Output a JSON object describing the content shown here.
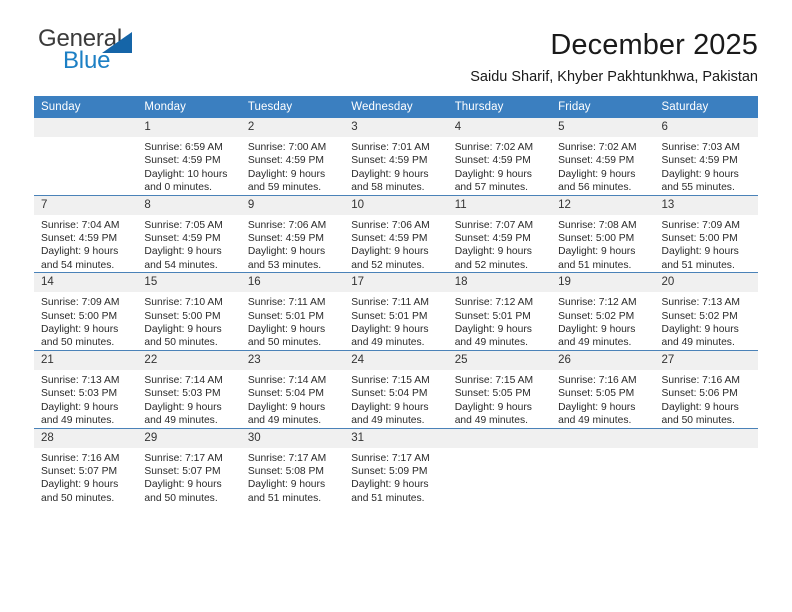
{
  "brand": {
    "name_top": "General",
    "name_bottom": "Blue",
    "triangle_color": "#1565a8",
    "blue_color": "#1c7fc4",
    "gray_color": "#3b3b3b"
  },
  "header": {
    "title": "December 2025",
    "subtitle": "Saidu Sharif, Khyber Pakhtunkhwa, Pakistan"
  },
  "theme": {
    "header_bg": "#3b7fc0",
    "header_text": "#ffffff",
    "daynum_bg": "#f0f0f0",
    "row_divider": "#4a82b8",
    "cell_bg": "#ffffff",
    "body_text": "#2a2a2a"
  },
  "weekday_headers": [
    "Sunday",
    "Monday",
    "Tuesday",
    "Wednesday",
    "Thursday",
    "Friday",
    "Saturday"
  ],
  "weeks": [
    [
      {
        "day": "",
        "sunrise": "",
        "sunset": "",
        "daylight_line1": "",
        "daylight_line2": "",
        "empty": true
      },
      {
        "day": "1",
        "sunrise": "Sunrise: 6:59 AM",
        "sunset": "Sunset: 4:59 PM",
        "daylight_line1": "Daylight: 10 hours",
        "daylight_line2": "and 0 minutes."
      },
      {
        "day": "2",
        "sunrise": "Sunrise: 7:00 AM",
        "sunset": "Sunset: 4:59 PM",
        "daylight_line1": "Daylight: 9 hours",
        "daylight_line2": "and 59 minutes."
      },
      {
        "day": "3",
        "sunrise": "Sunrise: 7:01 AM",
        "sunset": "Sunset: 4:59 PM",
        "daylight_line1": "Daylight: 9 hours",
        "daylight_line2": "and 58 minutes."
      },
      {
        "day": "4",
        "sunrise": "Sunrise: 7:02 AM",
        "sunset": "Sunset: 4:59 PM",
        "daylight_line1": "Daylight: 9 hours",
        "daylight_line2": "and 57 minutes."
      },
      {
        "day": "5",
        "sunrise": "Sunrise: 7:02 AM",
        "sunset": "Sunset: 4:59 PM",
        "daylight_line1": "Daylight: 9 hours",
        "daylight_line2": "and 56 minutes."
      },
      {
        "day": "6",
        "sunrise": "Sunrise: 7:03 AM",
        "sunset": "Sunset: 4:59 PM",
        "daylight_line1": "Daylight: 9 hours",
        "daylight_line2": "and 55 minutes."
      }
    ],
    [
      {
        "day": "7",
        "sunrise": "Sunrise: 7:04 AM",
        "sunset": "Sunset: 4:59 PM",
        "daylight_line1": "Daylight: 9 hours",
        "daylight_line2": "and 54 minutes."
      },
      {
        "day": "8",
        "sunrise": "Sunrise: 7:05 AM",
        "sunset": "Sunset: 4:59 PM",
        "daylight_line1": "Daylight: 9 hours",
        "daylight_line2": "and 54 minutes."
      },
      {
        "day": "9",
        "sunrise": "Sunrise: 7:06 AM",
        "sunset": "Sunset: 4:59 PM",
        "daylight_line1": "Daylight: 9 hours",
        "daylight_line2": "and 53 minutes."
      },
      {
        "day": "10",
        "sunrise": "Sunrise: 7:06 AM",
        "sunset": "Sunset: 4:59 PM",
        "daylight_line1": "Daylight: 9 hours",
        "daylight_line2": "and 52 minutes."
      },
      {
        "day": "11",
        "sunrise": "Sunrise: 7:07 AM",
        "sunset": "Sunset: 4:59 PM",
        "daylight_line1": "Daylight: 9 hours",
        "daylight_line2": "and 52 minutes."
      },
      {
        "day": "12",
        "sunrise": "Sunrise: 7:08 AM",
        "sunset": "Sunset: 5:00 PM",
        "daylight_line1": "Daylight: 9 hours",
        "daylight_line2": "and 51 minutes."
      },
      {
        "day": "13",
        "sunrise": "Sunrise: 7:09 AM",
        "sunset": "Sunset: 5:00 PM",
        "daylight_line1": "Daylight: 9 hours",
        "daylight_line2": "and 51 minutes."
      }
    ],
    [
      {
        "day": "14",
        "sunrise": "Sunrise: 7:09 AM",
        "sunset": "Sunset: 5:00 PM",
        "daylight_line1": "Daylight: 9 hours",
        "daylight_line2": "and 50 minutes."
      },
      {
        "day": "15",
        "sunrise": "Sunrise: 7:10 AM",
        "sunset": "Sunset: 5:00 PM",
        "daylight_line1": "Daylight: 9 hours",
        "daylight_line2": "and 50 minutes."
      },
      {
        "day": "16",
        "sunrise": "Sunrise: 7:11 AM",
        "sunset": "Sunset: 5:01 PM",
        "daylight_line1": "Daylight: 9 hours",
        "daylight_line2": "and 50 minutes."
      },
      {
        "day": "17",
        "sunrise": "Sunrise: 7:11 AM",
        "sunset": "Sunset: 5:01 PM",
        "daylight_line1": "Daylight: 9 hours",
        "daylight_line2": "and 49 minutes."
      },
      {
        "day": "18",
        "sunrise": "Sunrise: 7:12 AM",
        "sunset": "Sunset: 5:01 PM",
        "daylight_line1": "Daylight: 9 hours",
        "daylight_line2": "and 49 minutes."
      },
      {
        "day": "19",
        "sunrise": "Sunrise: 7:12 AM",
        "sunset": "Sunset: 5:02 PM",
        "daylight_line1": "Daylight: 9 hours",
        "daylight_line2": "and 49 minutes."
      },
      {
        "day": "20",
        "sunrise": "Sunrise: 7:13 AM",
        "sunset": "Sunset: 5:02 PM",
        "daylight_line1": "Daylight: 9 hours",
        "daylight_line2": "and 49 minutes."
      }
    ],
    [
      {
        "day": "21",
        "sunrise": "Sunrise: 7:13 AM",
        "sunset": "Sunset: 5:03 PM",
        "daylight_line1": "Daylight: 9 hours",
        "daylight_line2": "and 49 minutes."
      },
      {
        "day": "22",
        "sunrise": "Sunrise: 7:14 AM",
        "sunset": "Sunset: 5:03 PM",
        "daylight_line1": "Daylight: 9 hours",
        "daylight_line2": "and 49 minutes."
      },
      {
        "day": "23",
        "sunrise": "Sunrise: 7:14 AM",
        "sunset": "Sunset: 5:04 PM",
        "daylight_line1": "Daylight: 9 hours",
        "daylight_line2": "and 49 minutes."
      },
      {
        "day": "24",
        "sunrise": "Sunrise: 7:15 AM",
        "sunset": "Sunset: 5:04 PM",
        "daylight_line1": "Daylight: 9 hours",
        "daylight_line2": "and 49 minutes."
      },
      {
        "day": "25",
        "sunrise": "Sunrise: 7:15 AM",
        "sunset": "Sunset: 5:05 PM",
        "daylight_line1": "Daylight: 9 hours",
        "daylight_line2": "and 49 minutes."
      },
      {
        "day": "26",
        "sunrise": "Sunrise: 7:16 AM",
        "sunset": "Sunset: 5:05 PM",
        "daylight_line1": "Daylight: 9 hours",
        "daylight_line2": "and 49 minutes."
      },
      {
        "day": "27",
        "sunrise": "Sunrise: 7:16 AM",
        "sunset": "Sunset: 5:06 PM",
        "daylight_line1": "Daylight: 9 hours",
        "daylight_line2": "and 50 minutes."
      }
    ],
    [
      {
        "day": "28",
        "sunrise": "Sunrise: 7:16 AM",
        "sunset": "Sunset: 5:07 PM",
        "daylight_line1": "Daylight: 9 hours",
        "daylight_line2": "and 50 minutes."
      },
      {
        "day": "29",
        "sunrise": "Sunrise: 7:17 AM",
        "sunset": "Sunset: 5:07 PM",
        "daylight_line1": "Daylight: 9 hours",
        "daylight_line2": "and 50 minutes."
      },
      {
        "day": "30",
        "sunrise": "Sunrise: 7:17 AM",
        "sunset": "Sunset: 5:08 PM",
        "daylight_line1": "Daylight: 9 hours",
        "daylight_line2": "and 51 minutes."
      },
      {
        "day": "31",
        "sunrise": "Sunrise: 7:17 AM",
        "sunset": "Sunset: 5:09 PM",
        "daylight_line1": "Daylight: 9 hours",
        "daylight_line2": "and 51 minutes."
      },
      {
        "day": "",
        "sunrise": "",
        "sunset": "",
        "daylight_line1": "",
        "daylight_line2": "",
        "empty": true
      },
      {
        "day": "",
        "sunrise": "",
        "sunset": "",
        "daylight_line1": "",
        "daylight_line2": "",
        "empty": true
      },
      {
        "day": "",
        "sunrise": "",
        "sunset": "",
        "daylight_line1": "",
        "daylight_line2": "",
        "empty": true
      }
    ]
  ]
}
